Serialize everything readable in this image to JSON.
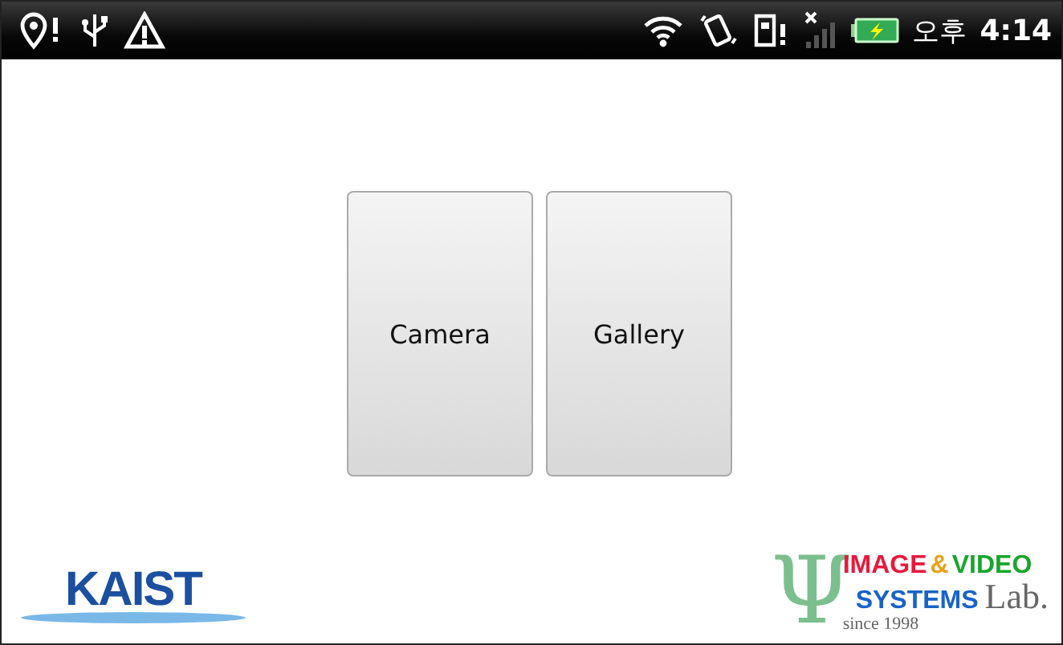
{
  "status_bar": {
    "ampm": "오후",
    "time": "4:14"
  },
  "buttons": [
    {
      "label": "Camera"
    },
    {
      "label": "Gallery"
    }
  ],
  "kaist_logo": {
    "text": "KAIST"
  },
  "lab_logo": {
    "symbol": "Ψ",
    "words": [
      {
        "text": "IMAGE",
        "color": "#e8193c"
      },
      {
        "text": "&",
        "color": "#e8a21a"
      },
      {
        "text": "VIDEO",
        "color": "#1aa52e"
      }
    ],
    "line2": "SYSTEMS",
    "lab": "Lab.",
    "since": "since 1998"
  }
}
